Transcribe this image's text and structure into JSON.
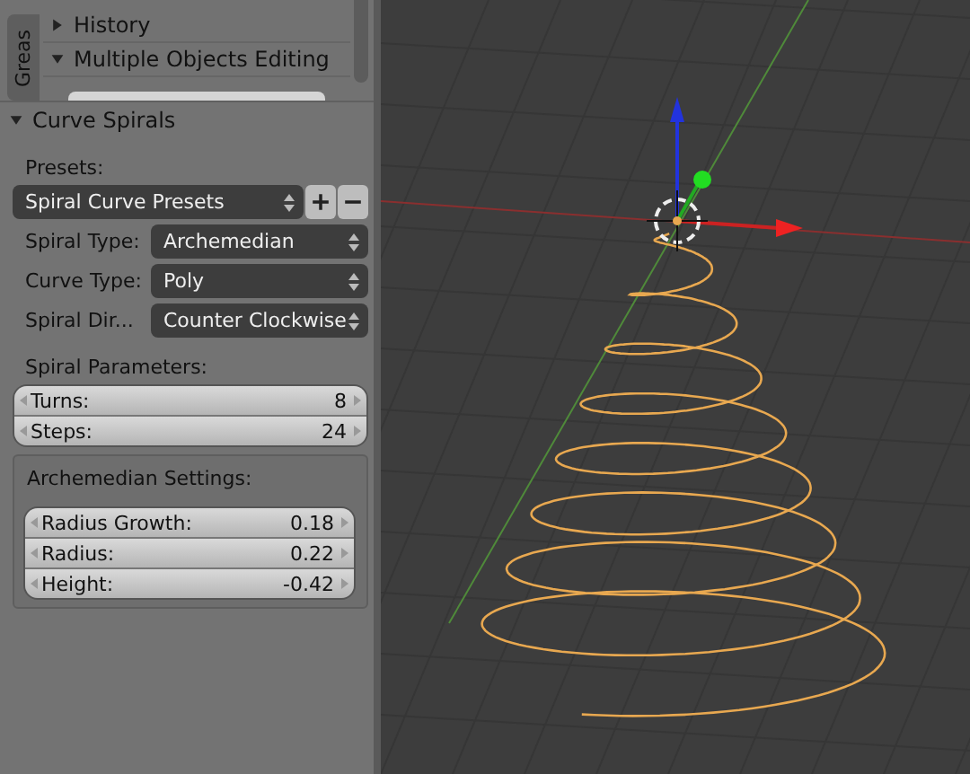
{
  "tab_strip": {
    "label": "Greas"
  },
  "collapsed_panels": [
    {
      "title": "History",
      "expanded": false
    },
    {
      "title": "Multiple Objects Editing",
      "expanded": true
    }
  ],
  "operator_panel": {
    "title": "Curve Spirals",
    "expanded": true,
    "presets_label": "Presets:",
    "preset_menu": "Spiral Curve Presets",
    "dropdowns": [
      {
        "label": "Spiral Type:",
        "value": "Archemedian"
      },
      {
        "label": "Curve Type:",
        "value": "Poly"
      },
      {
        "label": "Spiral Dir...",
        "value": "Counter Clockwise"
      }
    ],
    "parameters_label": "Spiral Parameters:",
    "parameters": [
      {
        "label": "Turns:",
        "value": "8"
      },
      {
        "label": "Steps:",
        "value": "24"
      }
    ],
    "settings_box": {
      "title": "Archemedian Settings:",
      "fields": [
        {
          "label": "Radius Growth:",
          "value": "0.18"
        },
        {
          "label": "Radius:",
          "value": "0.22"
        },
        {
          "label": "Height:",
          "value": "-0.42"
        }
      ]
    }
  }
}
